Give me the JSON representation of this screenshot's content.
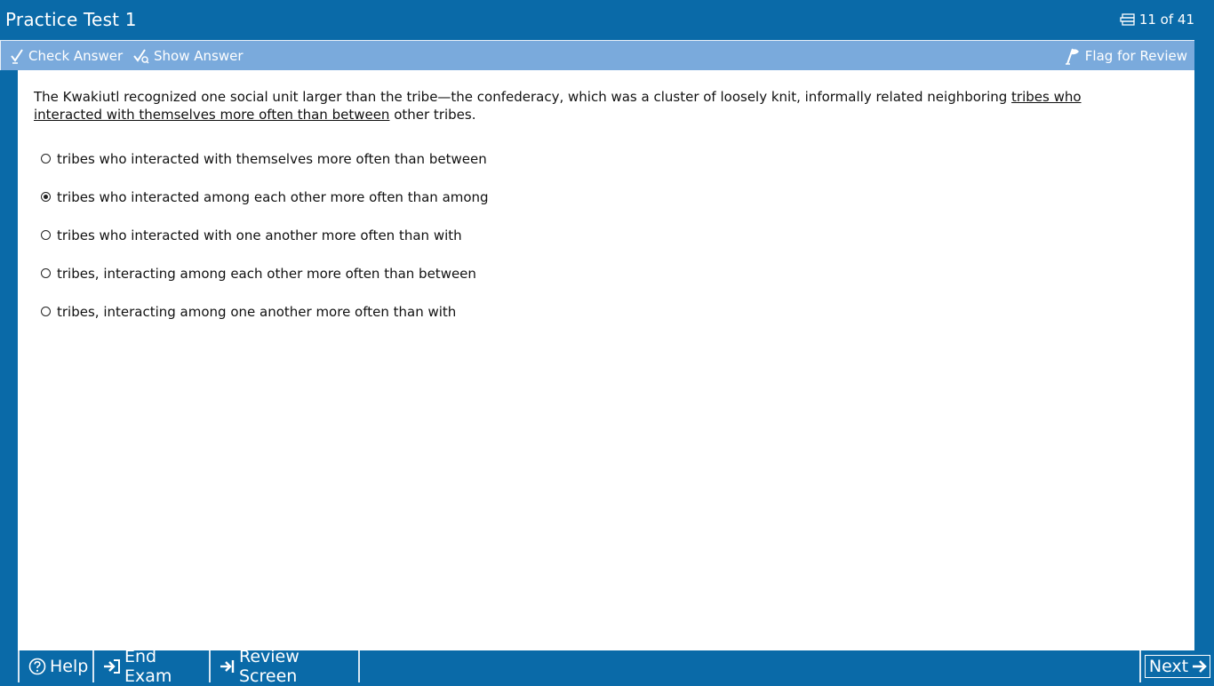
{
  "window": {
    "title": "Practice Test 1",
    "progress": "11 of 41"
  },
  "toolbar": {
    "check_answer": "Check Answer",
    "show_answer": "Show Answer",
    "flag_for_review": "Flag for Review"
  },
  "question": {
    "stem_before": "The Kwakiutl recognized one social unit larger than the tribe—the confederacy, which was a cluster of loosely knit, informally related neighboring ",
    "stem_underlined": "tribes who interacted with themselves more often than between",
    "stem_after": " other tribes.",
    "choices": [
      {
        "text": "tribes who interacted with themselves more often than between",
        "selected": false
      },
      {
        "text": "tribes who interacted among each other more often than among",
        "selected": true
      },
      {
        "text": "tribes who interacted with one another more often than with",
        "selected": false
      },
      {
        "text": "tribes, interacting among each other more often than between",
        "selected": false
      },
      {
        "text": "tribes, interacting among one another more often than with",
        "selected": false
      }
    ]
  },
  "bottom_bar": {
    "help": "Help",
    "end_exam": "End Exam",
    "review_screen": "Review Screen",
    "next": "Next"
  },
  "colors": {
    "chrome_blue": "#0a6aa8",
    "toolbar_blue": "#7aaadc",
    "content_bg": "#ffffff"
  }
}
